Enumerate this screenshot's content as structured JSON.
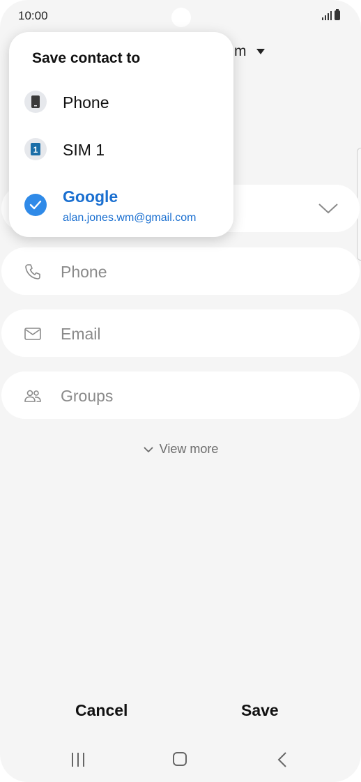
{
  "status_bar": {
    "time": "10:00"
  },
  "header": {
    "account_suffix": "m"
  },
  "save_dialog": {
    "title": "Save contact to",
    "options": [
      {
        "label": "Phone"
      },
      {
        "label": "SIM 1",
        "badge": "1"
      },
      {
        "label": "Google",
        "email": "alan.jones.wm@gmail.com",
        "selected": true
      }
    ]
  },
  "form": {
    "phone_placeholder": "Phone",
    "email_placeholder": "Email",
    "groups_placeholder": "Groups",
    "view_more_label": "View more"
  },
  "actions": {
    "cancel_label": "Cancel",
    "save_label": "Save"
  },
  "colors": {
    "accent": "#1a6fd0",
    "check_circle": "#2f8ae8",
    "sim_badge": "#1b6ea8"
  }
}
